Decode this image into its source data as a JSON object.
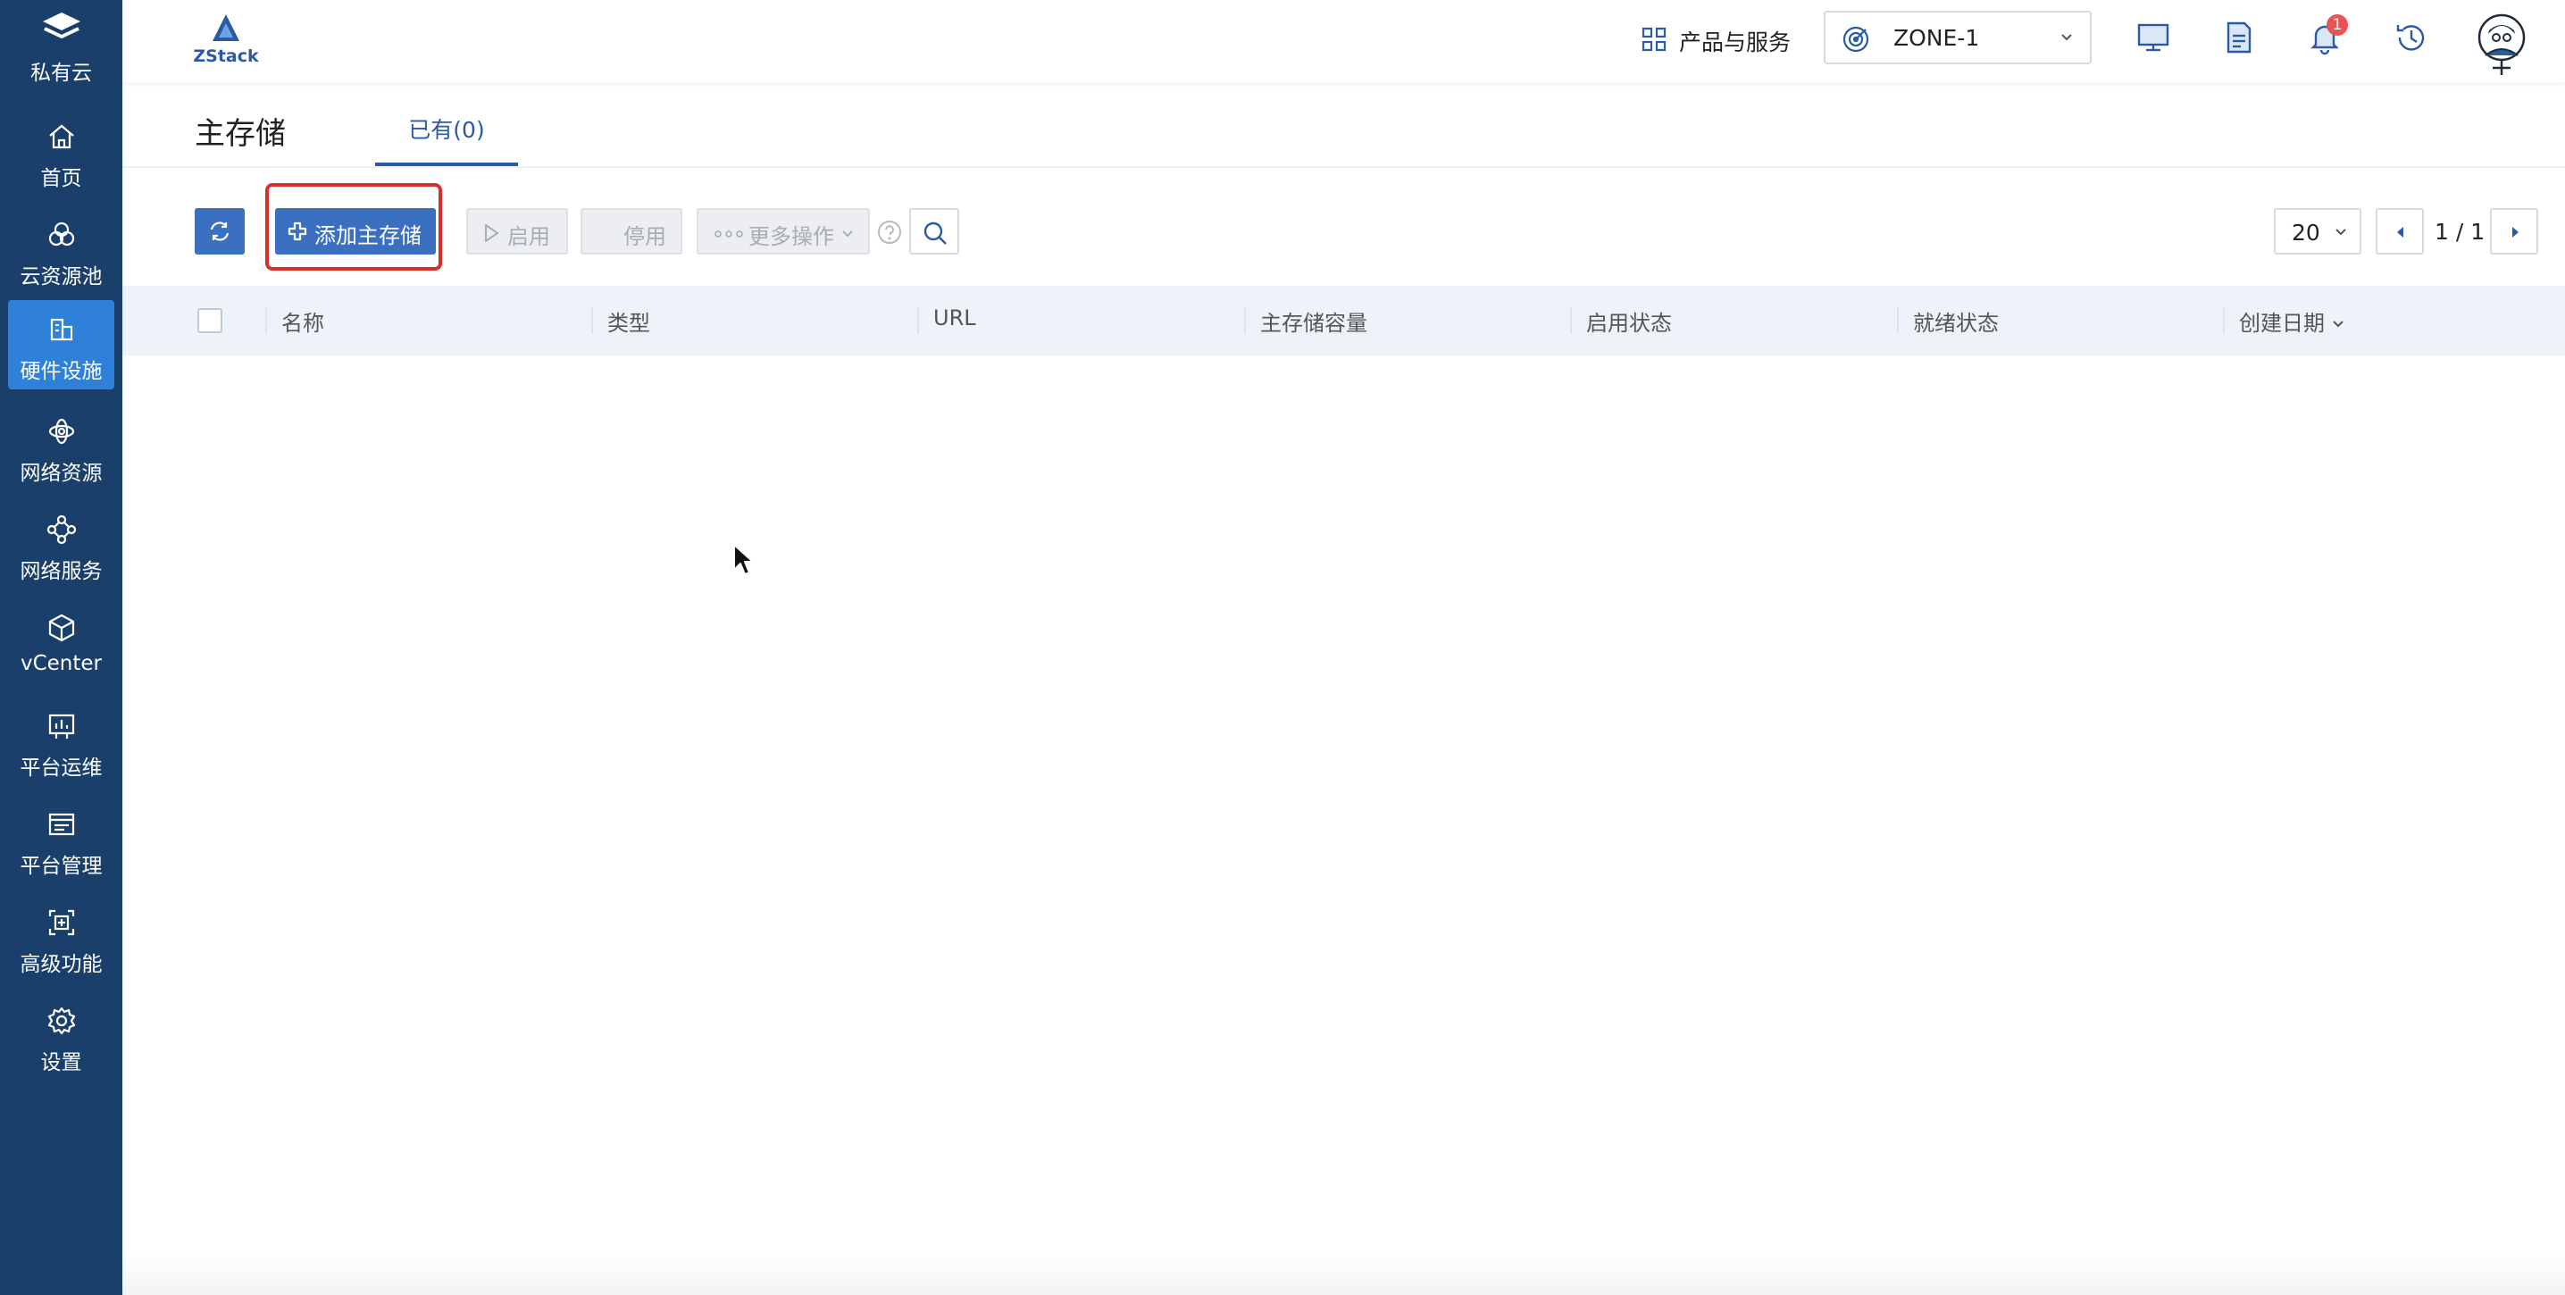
{
  "sidebar": {
    "brand_label": "私有云",
    "items": [
      {
        "label": "首页",
        "icon": "home-icon"
      },
      {
        "label": "云资源池",
        "icon": "resource-pool-icon"
      },
      {
        "label": "硬件设施",
        "icon": "hardware-icon",
        "active": true
      },
      {
        "label": "网络资源",
        "icon": "network-resource-icon"
      },
      {
        "label": "网络服务",
        "icon": "network-service-icon"
      },
      {
        "label": "vCenter",
        "icon": "vcenter-cube-icon"
      },
      {
        "label": "平台运维",
        "icon": "monitor-chart-icon"
      },
      {
        "label": "平台管理",
        "icon": "management-icon"
      },
      {
        "label": "高级功能",
        "icon": "advanced-feature-icon"
      },
      {
        "label": "设置",
        "icon": "gear-icon"
      }
    ]
  },
  "topbar": {
    "logo_text": "ZStack",
    "products_label": "产品与服务",
    "zone_label": "ZONE-1",
    "notification_count": "1"
  },
  "page": {
    "title": "主存储",
    "tab_label": "已有(0)"
  },
  "toolbar": {
    "add_label": "添加主存储",
    "enable_label": "启用",
    "disable_label": "停用",
    "more_label": "更多操作",
    "page_size": "20",
    "page_indicator": "1 / 1"
  },
  "table": {
    "columns": [
      "名称",
      "类型",
      "URL",
      "主存储容量",
      "启用状态",
      "就绪状态",
      "创建日期"
    ]
  },
  "colors": {
    "sidebar_bg": "#1a3f6b",
    "sidebar_active": "#2f80d8",
    "primary_button": "#3b6fc0",
    "highlight_border": "#d9302b",
    "badge": "#e85454"
  }
}
